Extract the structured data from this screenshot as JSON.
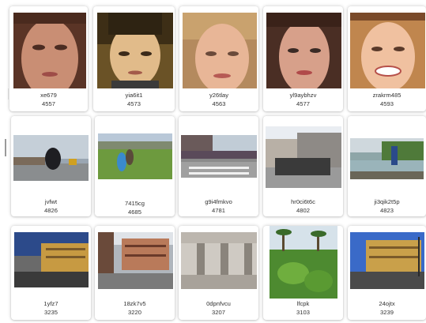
{
  "gallery": {
    "rows": [
      {
        "items": [
          {
            "name": "xe679",
            "count": "4557",
            "scene": "face-1"
          },
          {
            "name": "yia6it1",
            "count": "4573",
            "scene": "face-2"
          },
          {
            "name": "y26tlay",
            "count": "4563",
            "scene": "face-3"
          },
          {
            "name": "yl9aybhzv",
            "count": "4577",
            "scene": "face-4"
          },
          {
            "name": "zrakrm485",
            "count": "4593",
            "scene": "face-5"
          }
        ]
      },
      {
        "items": [
          {
            "name": "jvfwt",
            "count": "4826",
            "scene": "street-1"
          },
          {
            "name": "7415cg",
            "count": "4685",
            "scene": "park-1"
          },
          {
            "name": "g9i4fmkvo",
            "count": "4781",
            "scene": "crosswalk-1"
          },
          {
            "name": "hr0ci6t6c",
            "count": "4802",
            "scene": "street-2"
          },
          {
            "name": "ji3qik2t5p",
            "count": "4823",
            "scene": "river-1"
          }
        ]
      },
      {
        "items": [
          {
            "name": "1yfz7",
            "count": "3235",
            "scene": "building-1"
          },
          {
            "name": "18zk7v5",
            "count": "3220",
            "scene": "building-2"
          },
          {
            "name": "0dpnfvcu",
            "count": "3207",
            "scene": "arcade-1"
          },
          {
            "name": "lfcpk",
            "count": "3103",
            "scene": "garden-1"
          },
          {
            "name": "24ojtx",
            "count": "3239",
            "scene": "building-3"
          }
        ]
      }
    ]
  }
}
